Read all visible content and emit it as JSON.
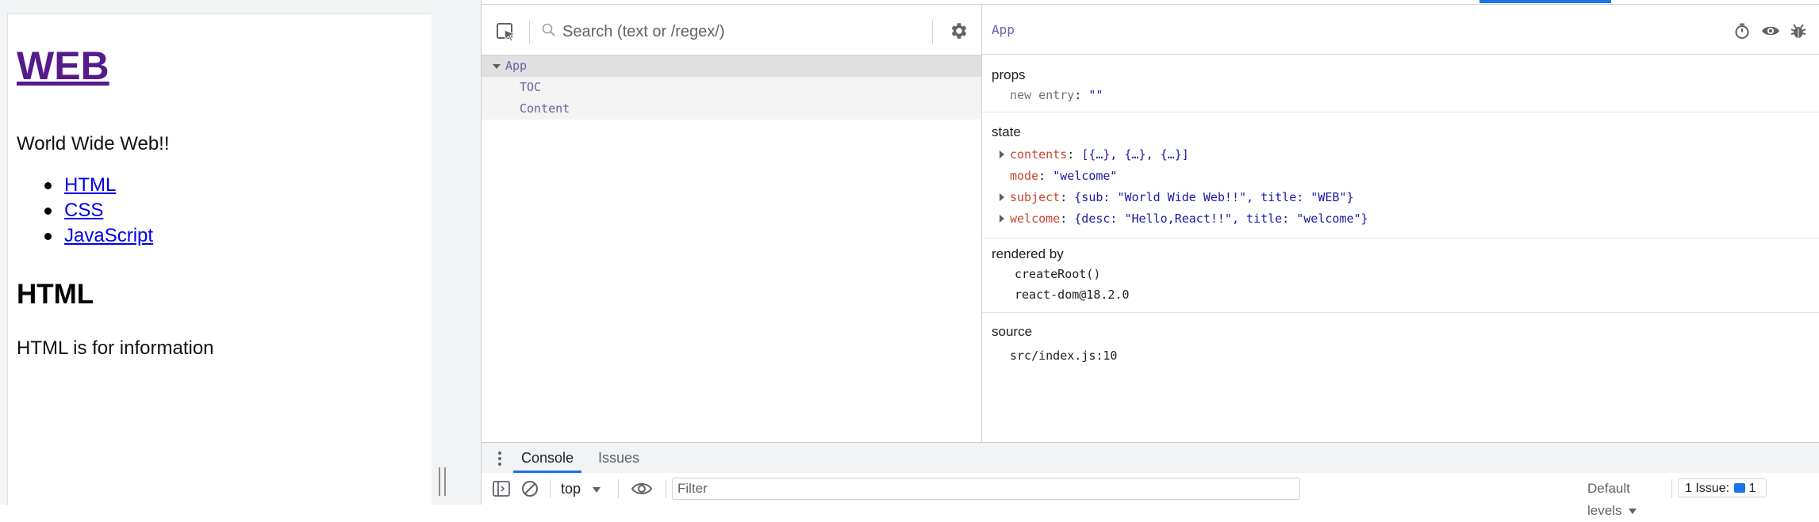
{
  "page": {
    "title": "WEB",
    "subtitle": "World Wide Web!!",
    "toc": [
      "HTML",
      "CSS",
      "JavaScript"
    ],
    "heading": "HTML",
    "description": "HTML is for information"
  },
  "devtools": {
    "search_placeholder": "Search (text or /regex/)",
    "tree": {
      "root": "App",
      "children": [
        "TOC",
        "Content"
      ]
    },
    "inspector": {
      "component": "App",
      "props": {
        "title": "props",
        "entries": [
          {
            "key": "new entry",
            "value": "\"\""
          }
        ]
      },
      "state": {
        "title": "state",
        "entries": [
          {
            "key": "contents",
            "value": "[{…}, {…}, {…}]",
            "expandable": true
          },
          {
            "key": "mode",
            "value": "\"welcome\"",
            "expandable": false
          },
          {
            "key": "subject",
            "value": "{sub: \"World Wide Web!!\", title: \"WEB\"}",
            "expandable": true
          },
          {
            "key": "welcome",
            "value": "{desc: \"Hello,React!!\", title: \"welcome\"}",
            "expandable": true
          }
        ]
      },
      "rendered_by": {
        "title": "rendered by",
        "items": [
          "createRoot()",
          "react-dom@18.2.0"
        ]
      },
      "source": {
        "title": "source",
        "value": "src/index.js:10"
      }
    },
    "drawer": {
      "tabs": [
        "Console",
        "Issues"
      ],
      "context": "top",
      "filter_placeholder": "Filter",
      "levels": "Default levels",
      "issues_label": "1 Issue:",
      "issues_count": "1"
    },
    "colors": {
      "accent": "#1a73e8",
      "component_purple": "#6e5ea8",
      "state_key_red": "#c6472d",
      "value_blue": "#1a1aa6"
    }
  }
}
